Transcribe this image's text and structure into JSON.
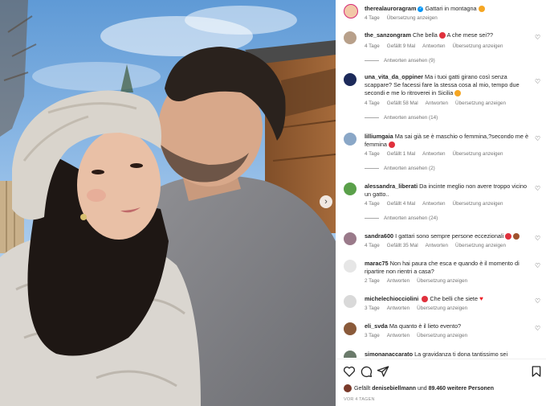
{
  "post": {
    "author": "therealauroragram",
    "caption": "Gattari in montagna",
    "age": "4 Tage",
    "translate": "Übersetzung anzeigen",
    "likes_avatar_user": "denisebiellmann",
    "likes_prefix": "Gefällt",
    "likes_user": "denisebiellmann",
    "likes_mid": "und",
    "likes_count": "89.460 weitere Personen",
    "time_label": "VOR 4 TAGEN"
  },
  "comments": [
    {
      "user": "the_sanzongram",
      "text": "Che bella",
      "text2": "A che mese sei??",
      "age": "4 Tage",
      "likes": "Gefällt 9 Mal",
      "reply": "Antworten",
      "translate": "Übersetzung anzeigen",
      "view_replies": "Antworten ansehen (9)"
    },
    {
      "user": "una_vita_da_oppiner",
      "text": "Ma i tuoi gatti girano così senza scappare? Se facessi fare la stessa cosa al mio, tempo due secondi e me lo ritroverei in Sicilia",
      "age": "4 Tage",
      "likes": "Gefällt 58 Mal",
      "reply": "Antworten",
      "translate": "Übersetzung anzeigen",
      "view_replies": "Antworten ansehen (14)"
    },
    {
      "user": "lilliumgaia",
      "text": "Ma sai già se è maschio o femmina,?secondo me è femmina",
      "age": "4 Tage",
      "likes": "Gefällt 1 Mal",
      "reply": "Antworten",
      "translate": "Übersetzung anzeigen",
      "view_replies": "Antworten ansehen (2)"
    },
    {
      "user": "alessandra_liberati",
      "text": "Da incinte meglio non avere troppo vicino un gatto..",
      "age": "4 Tage",
      "likes": "Gefällt 4 Mal",
      "reply": "Antworten",
      "translate": "Übersetzung anzeigen",
      "view_replies": "Antworten ansehen (24)"
    },
    {
      "user": "sandra600",
      "text": "I gattari sono sempre persone eccezionali",
      "age": "4 Tage",
      "likes": "Gefällt 35 Mal",
      "reply": "Antworten",
      "translate": "Übersetzung anzeigen"
    },
    {
      "user": "marac75",
      "text": "Non hai paura che esca e quando è il momento di ripartire non rientri a casa?",
      "age": "2 Tage",
      "reply": "Antworten",
      "translate": "Übersetzung anzeigen"
    },
    {
      "user": "michelechiocciolini",
      "text": "Che belli che siete",
      "age": "3 Tage",
      "reply": "Antworten",
      "translate": "Übersetzung anzeigen"
    },
    {
      "user": "eli_svda",
      "text": "Ma quanto è il lieto evento?",
      "age": "3 Tage",
      "reply": "Antworten",
      "translate": "Übersetzung anzeigen"
    },
    {
      "user": "simonanaccarato",
      "text": "La gravidanza ti dona tantissimo sei"
    }
  ],
  "icons": {
    "like": "heart-outline-icon",
    "comment": "comment-bubble-icon",
    "share": "paper-plane-icon",
    "save": "bookmark-icon",
    "next": "chevron-right-icon"
  },
  "colors": {
    "verified": "#0095f6",
    "meta_text": "#737373",
    "sky": "#7fb0e0",
    "red_heart": "#ed1c24"
  }
}
